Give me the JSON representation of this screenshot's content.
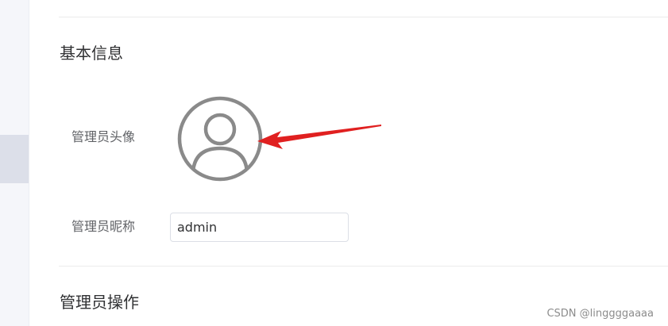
{
  "sections": {
    "basic_info_title": "基本信息",
    "admin_actions_title": "管理员操作"
  },
  "fields": {
    "avatar_label": "管理员头像",
    "nickname_label": "管理员昵称",
    "nickname_value": "admin"
  },
  "icons": {
    "avatar": "user-avatar-icon",
    "annotation": "red-arrow"
  },
  "colors": {
    "avatar_stroke": "#8a8a8a",
    "arrow": "#e02020"
  },
  "watermark": "CSDN @linggggaaaa"
}
